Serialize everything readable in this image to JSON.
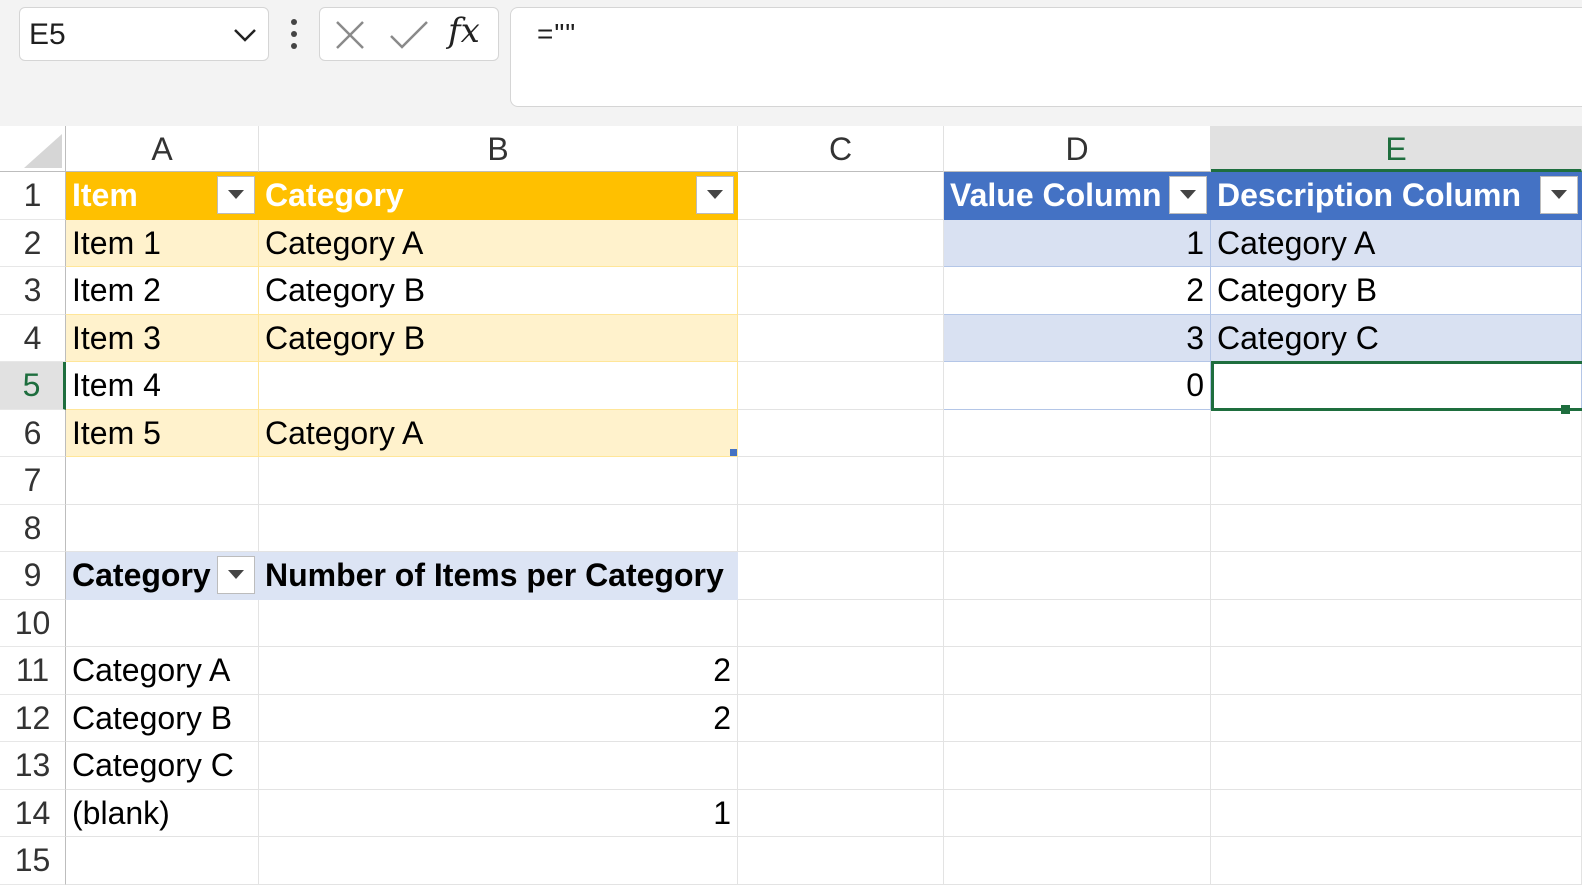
{
  "formula_bar": {
    "name_box": "E5",
    "formula": "=\"\"",
    "cancel_icon": "x-icon",
    "enter_icon": "check-icon",
    "function_icon": "fx-icon"
  },
  "columns": [
    "A",
    "B",
    "C",
    "D",
    "E"
  ],
  "selected_column": "E",
  "rows": [
    "1",
    "2",
    "3",
    "4",
    "5",
    "6",
    "7",
    "8",
    "9",
    "10",
    "11",
    "12",
    "13",
    "14",
    "15"
  ],
  "selected_row": "5",
  "table1": {
    "headers": [
      "Item",
      "Category"
    ],
    "rows": [
      [
        "Item 1",
        "Category A"
      ],
      [
        "Item 2",
        "Category B"
      ],
      [
        "Item 3",
        "Category B"
      ],
      [
        "Item 4",
        ""
      ],
      [
        "Item 5",
        "Category A"
      ]
    ]
  },
  "table2": {
    "headers": [
      "Value Column",
      "Description Column"
    ],
    "rows": [
      [
        "1",
        "Category A"
      ],
      [
        "2",
        "Category B"
      ],
      [
        "3",
        "Category C"
      ],
      [
        "0",
        ""
      ]
    ]
  },
  "pivot": {
    "headers": [
      "Category",
      "Number of Items per Category"
    ],
    "rows": [
      [
        "",
        ""
      ],
      [
        "Category A",
        "2"
      ],
      [
        "Category B",
        "2"
      ],
      [
        "Category C",
        ""
      ],
      [
        "(blank)",
        "1"
      ]
    ]
  },
  "colors": {
    "table1_header": "#ffc000",
    "table1_band": "#fff2cc",
    "table2_header": "#4472c4",
    "table2_band": "#d9e1f2",
    "pivot_header": "#dce4f4",
    "selection": "#1e6e3e"
  }
}
